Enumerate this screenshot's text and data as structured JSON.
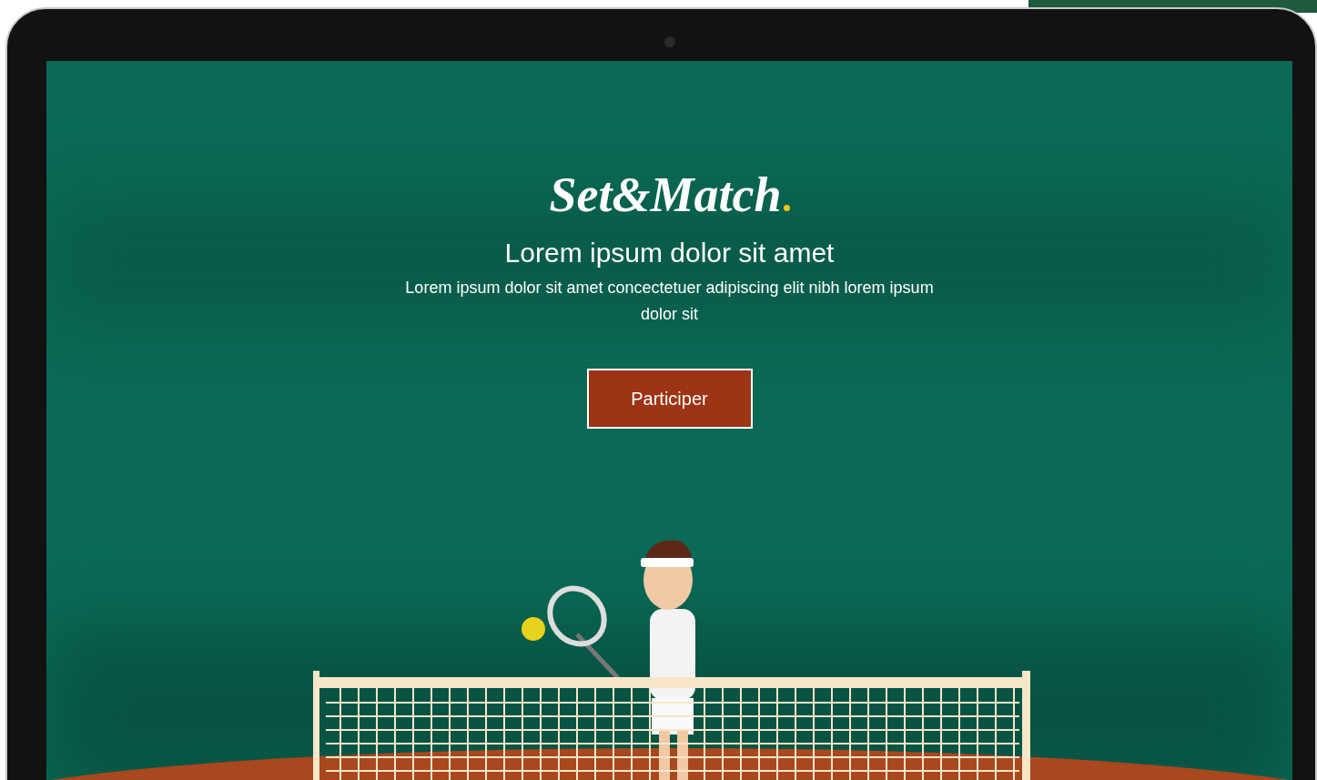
{
  "logo": {
    "text": "Set&Match"
  },
  "hero": {
    "title": "Lorem ipsum dolor sit amet",
    "subtitle": "Lorem ipsum dolor sit amet concectetuer adipiscing elit nibh lorem ipsum dolor sit"
  },
  "button": {
    "label": "Participer"
  }
}
